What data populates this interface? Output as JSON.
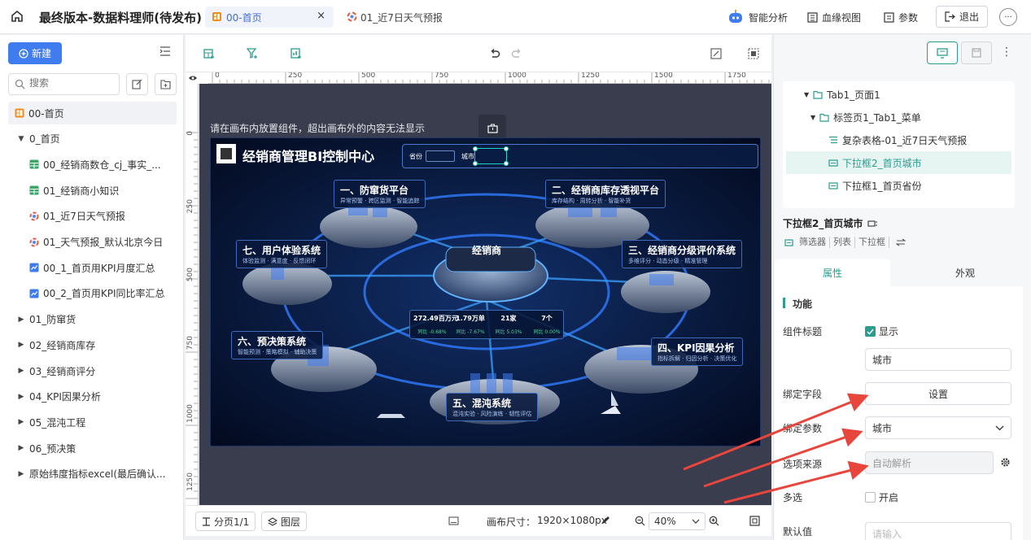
{
  "app": {
    "title": "最终版本-数据料理师(待发布)"
  },
  "tabs": [
    {
      "label": "00-首页",
      "close": "×"
    },
    {
      "label": "01_近7日天气预报"
    }
  ],
  "topbar": {
    "ai_label": "智能分析",
    "lineage_label": "血缘视图",
    "params_label": "参数",
    "exit_label": "退出"
  },
  "left": {
    "new_label": "新建",
    "search_placeholder": "搜索",
    "tree": [
      {
        "label": "00-首页",
        "icon": "dashboard-icon",
        "indent": 0,
        "selected": true
      },
      {
        "label": "0_首页",
        "caret": "▼",
        "indent": 1
      },
      {
        "label": "00_经销商数仓_cj_事实_...",
        "icon": "table-icon",
        "indent": 2
      },
      {
        "label": "01_经销商小知识",
        "icon": "table-icon",
        "indent": 2
      },
      {
        "label": "01_近7日天气预报",
        "icon": "weather-icon",
        "indent": 2
      },
      {
        "label": "01_天气预报_默认北京今日",
        "icon": "weather-icon",
        "indent": 2
      },
      {
        "label": "00_1_首页用KPI月度汇总",
        "icon": "chart-icon",
        "indent": 2
      },
      {
        "label": "00_2_首页用KPI同比率汇总",
        "icon": "chart-icon",
        "indent": 2
      },
      {
        "label": "01_防窜货",
        "caret": "▶",
        "indent": 1
      },
      {
        "label": "02_经销商库存",
        "caret": "▶",
        "indent": 1
      },
      {
        "label": "03_经销商评分",
        "caret": "▶",
        "indent": 1
      },
      {
        "label": "04_KPI因果分析",
        "caret": "▶",
        "indent": 1
      },
      {
        "label": "05_混沌工程",
        "caret": "▶",
        "indent": 1
      },
      {
        "label": "06_预决策",
        "caret": "▶",
        "indent": 1
      },
      {
        "label": "原始纬度指标excel(最后确认...",
        "caret": "▶",
        "indent": 1
      }
    ]
  },
  "ruler": {
    "top": [
      "0",
      "250",
      "500",
      "750",
      "1000",
      "1250",
      "1500",
      "1750"
    ],
    "left": [
      "0",
      "250",
      "500",
      "750",
      "1000",
      "1250"
    ]
  },
  "canvas": {
    "hint": "请在画布内放置组件，超出画布外的内容无法显示",
    "size_label": "画布尺寸：",
    "size_value": "1920×1080px",
    "zoom": "40%",
    "page_label": "分页1/1",
    "layer_label": "图层"
  },
  "dashboard": {
    "title": "经销商管理BI控制中心",
    "filter1": "省份",
    "filter2": "城市",
    "center": "经销商",
    "modules": [
      {
        "title": "一、防窜货平台",
        "sub": "异常预警 · 跨区监测 · 智能追踪"
      },
      {
        "title": "二、经销商库存透视平台",
        "sub": "库存结构 · 周转分析 · 智能补货"
      },
      {
        "title": "三、经销商分级评价系统",
        "sub": "多维评分 · 动态分级 · 精准管理"
      },
      {
        "title": "四、KPI因果分析",
        "sub": "指标拆解 · 归因分析 · 决策优化"
      },
      {
        "title": "五、混沌系统",
        "sub": "混沌实验 · 风险演练 · 韧性评估"
      },
      {
        "title": "六、预决策系统",
        "sub": "智能预测 · 策略模拟 · 辅助决策"
      },
      {
        "title": "七、用户体验系统",
        "sub": "体验监测 · 满意度 · 反馈闭环"
      }
    ],
    "kpis": [
      {
        "value": "272.49百万元",
        "rate": "同比 -0.68%"
      },
      {
        "value": "1.79万单",
        "rate": "同比 -7.67%"
      },
      {
        "value": "21家",
        "rate": "同比 5.03%"
      },
      {
        "value": "7个",
        "rate": "同比 0.00%"
      }
    ]
  },
  "right": {
    "tree": [
      {
        "label": "Tab1_页面1",
        "caret": "▼",
        "icon": "folder-icon"
      },
      {
        "label": "标签页1_Tab1_菜单",
        "caret": "▼",
        "icon": "folder-icon"
      },
      {
        "label": "复杂表格-01_近7日天气预报",
        "icon": "table-icon"
      },
      {
        "label": "下拉框2_首页城市",
        "icon": "dropdown-icon",
        "selected": true
      },
      {
        "label": "下拉框1_首页省份",
        "icon": "dropdown-icon"
      }
    ],
    "component_name": "下拉框2_首页城市",
    "tags": [
      "筛选器",
      "列表",
      "下拉框"
    ],
    "tab_props": "属性",
    "tab_look": "外观",
    "section": "功能",
    "title_label": "组件标题",
    "show_label": "显示",
    "title_value": "城市",
    "bind_field_label": "绑定字段",
    "bind_field_button": "设置",
    "bind_param_label": "绑定参数",
    "bind_param_value": "城市",
    "source_label": "选项来源",
    "source_value": "自动解析",
    "multi_label": "多选",
    "multi_value": "开启",
    "default_label": "默认值",
    "default_placeholder": "请输入"
  },
  "colors": {
    "accent": "#3f7cf0",
    "teal": "#2a9d8f",
    "arrow": "#e8453c",
    "canvas_bg": "#3a3d4e"
  }
}
